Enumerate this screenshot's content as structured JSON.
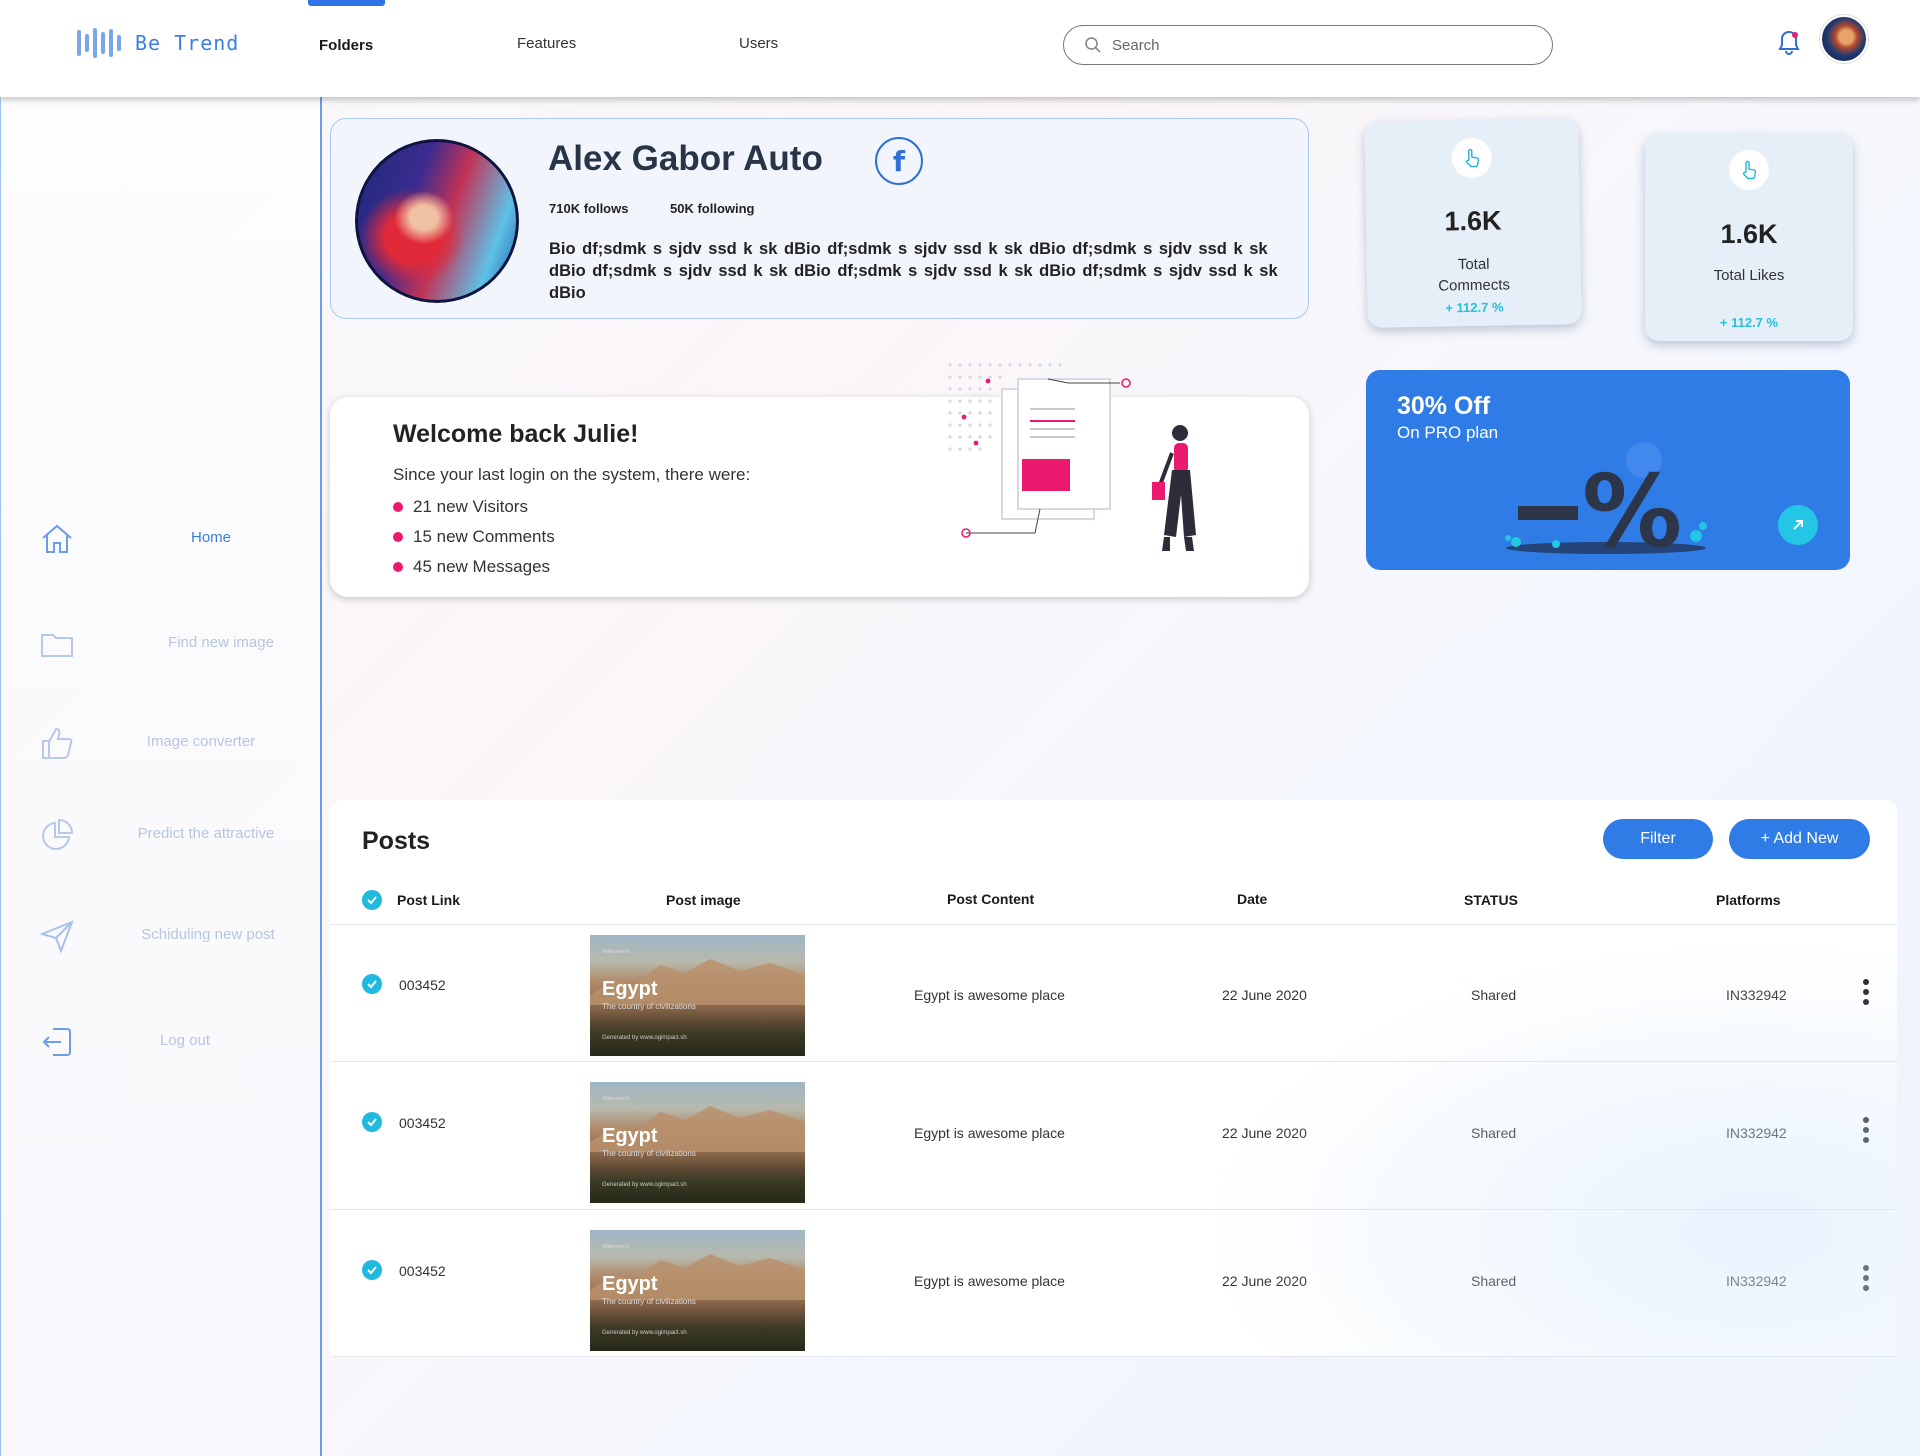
{
  "app": {
    "brand": "Be Trend",
    "nav_tabs": [
      "Folders",
      "Features",
      "Users"
    ],
    "active_tab": "Folders",
    "search_placeholder": "Search"
  },
  "sidebar": {
    "items": [
      {
        "label": "Home",
        "icon": "home-icon",
        "active": true
      },
      {
        "label": "Find new image",
        "icon": "folder-icon"
      },
      {
        "label": "Image converter",
        "icon": "thumbs-up-icon"
      },
      {
        "label": "Predict the attractive",
        "icon": "pie-chart-icon"
      },
      {
        "label": "Schiduling new post",
        "icon": "send-icon"
      },
      {
        "label": "Log out",
        "icon": "logout-icon"
      }
    ]
  },
  "profile": {
    "name": "Alex Gabor Auto",
    "follows": "710K follows",
    "following": "50K following",
    "bio": "Bio df;sdmk s sjdv ssd k sk  dBio df;sdmk s sjdv ssd k sk  dBio df;sdmk s sjdv ssd k sk  dBio df;sdmk s sjdv ssd k sk  dBio df;sdmk s sjdv ssd k sk  dBio df;sdmk s sjdv ssd k sk  dBio"
  },
  "stats": [
    {
      "value": "1.6K",
      "label_line1": "Total",
      "label_line2": "Commects",
      "change": "+ 112.7 %"
    },
    {
      "value": "1.6K",
      "label": "Total  Likes",
      "change": "+ 112.7 %"
    }
  ],
  "welcome": {
    "title": "Welcome back Julie!",
    "subtitle": "Since your last login on the system, there were:",
    "items": [
      "21 new Visitors",
      "15 new Comments",
      "45 new Messages"
    ]
  },
  "promo": {
    "title": "30% Off",
    "subtitle": "On PRO plan"
  },
  "posts": {
    "title": "Posts",
    "filter_label": "Filter",
    "add_label": "+ Add New",
    "columns": [
      "Post Link",
      "Post image",
      "Post Content",
      "Date",
      "STATUS",
      "Platforms"
    ],
    "thumb": {
      "small": "Welcome to",
      "title": "Egypt",
      "subtitle": "The country of civilizations",
      "footer": "Generated by www.ogimpact.sh"
    },
    "rows": [
      {
        "link": "003452",
        "content": "Egypt is awesome place",
        "date": "22 June 2020",
        "status": "Shared",
        "platform": "IN332942"
      },
      {
        "link": "003452",
        "content": "Egypt is awesome place",
        "date": "22 June 2020",
        "status": "Shared",
        "platform": "IN332942"
      },
      {
        "link": "003452",
        "content": "Egypt is awesome place",
        "date": "22 June 2020",
        "status": "Shared",
        "platform": "IN332942"
      }
    ]
  },
  "colors": {
    "accent": "#2f7ce6",
    "cyan": "#22b9e0",
    "pink": "#ec1a6f"
  }
}
